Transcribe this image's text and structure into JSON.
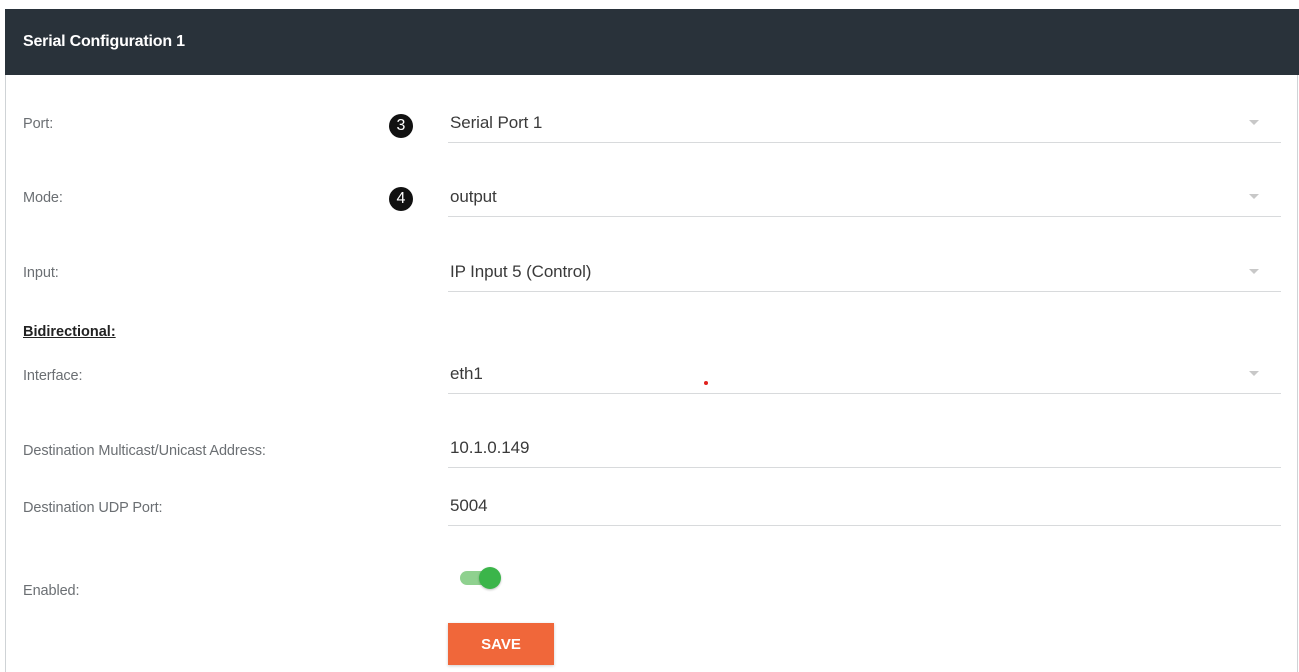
{
  "header": {
    "title": "Serial Configuration 1"
  },
  "form": {
    "port": {
      "label": "Port:",
      "value": "Serial Port 1",
      "callout": "3"
    },
    "mode": {
      "label": "Mode:",
      "value": "output",
      "callout": "4"
    },
    "input": {
      "label": "Input:",
      "value": "IP Input 5 (Control)"
    },
    "section": {
      "label": "Bidirectional:"
    },
    "interface": {
      "label": "Interface:",
      "value": "eth1"
    },
    "destination_address": {
      "label": "Destination Multicast/Unicast Address:",
      "value": "10.1.0.149"
    },
    "destination_port": {
      "label": "Destination UDP Port:",
      "value": "5004"
    },
    "enabled": {
      "label": "Enabled:",
      "state": "on"
    },
    "save_label": "SAVE"
  },
  "colors": {
    "header_bg": "#29323a",
    "accent": "#f0673a",
    "toggle_on": "#3bb54a"
  }
}
